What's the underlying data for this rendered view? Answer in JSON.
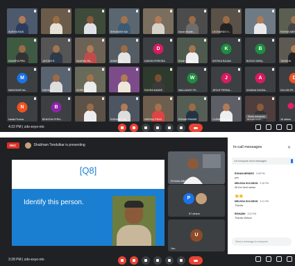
{
  "top_window": {
    "tiles": [
      {
        "kind": "video",
        "name": "SURIYA RAIS",
        "bg": "#4d5a6e",
        "skin": "#b07b55",
        "shirt": "#2b3d5c"
      },
      {
        "kind": "video",
        "name": "",
        "bg": "#6b5b4b",
        "skin": "#9b6b45",
        "shirt": "#e6e1d6"
      },
      {
        "kind": "video",
        "name": "",
        "bg": "#3e4b3a",
        "skin": "#8a5a3a",
        "shirt": "#dfe3e7"
      },
      {
        "kind": "video",
        "name": "SHIVANSH SAI",
        "bg": "#5b6770",
        "skin": "#a3724e",
        "shirt": "#3c5a74"
      },
      {
        "kind": "video",
        "name": "",
        "bg": "#7a6f5e",
        "skin": "#b07b55",
        "shirt": "#d8d3c9"
      },
      {
        "kind": "video",
        "name": "Karan Murde...",
        "bg": "#4c4c4c",
        "skin": "#9b6b45",
        "shirt": "#6d6d6d"
      },
      {
        "kind": "video",
        "name": "LEONARDO V...",
        "bg": "#5a5148",
        "skin": "#9b6b45",
        "shirt": "#222"
      },
      {
        "kind": "video",
        "name": "",
        "bg": "#6e7a84",
        "skin": "#b07b55",
        "shirt": "#eaeaea"
      },
      {
        "kind": "video",
        "name": "ROHAN MENDES",
        "bg": "#5a5f52",
        "skin": "#a3724e",
        "shirt": "#444"
      },
      {
        "kind": "video",
        "name": "DHAIRYA PRA",
        "bg": "#3f5a43",
        "skin": "#9b6b45",
        "shirt": "#333"
      },
      {
        "kind": "video",
        "name": "JAYDEN R",
        "bg": "#555",
        "skin": "#a3724e",
        "shirt": "#2d3a4a"
      },
      {
        "kind": "video",
        "name": "SAURAV PA...",
        "bg": "#6d6256",
        "skin": "#b07b55",
        "shirt": "#c14b4b"
      },
      {
        "kind": "video",
        "name": "ANIKET K...",
        "bg": "#545d64",
        "skin": "#9b6b45",
        "shirt": "#e4e4e4"
      },
      {
        "kind": "avatar",
        "letter": "D",
        "color": "#d81b60",
        "name": "DARON PEREIRA"
      },
      {
        "kind": "video",
        "name": "Rohit Gaikwa...",
        "bg": "#4d5a4d",
        "skin": "#a3724e",
        "shirt": "#eee"
      },
      {
        "kind": "avatar",
        "letter": "K",
        "color": "#1e8e3e",
        "name": "KRITIKA RAJAN"
      },
      {
        "kind": "avatar",
        "letter": "B",
        "color": "#1e8e3e",
        "name": "BOSCO MISQ..."
      },
      {
        "kind": "video",
        "name": "TANISHA",
        "bg": "#5e5a52",
        "skin": "#b07b55",
        "shirt": "#222"
      },
      {
        "kind": "avatar",
        "letter": "M",
        "color": "#1a73e8",
        "name": "MANOHAR NA..."
      },
      {
        "kind": "video",
        "name": "NIKHIL P",
        "bg": "#5a6370",
        "skin": "#9b6b45",
        "shirt": "#ddd"
      },
      {
        "kind": "video",
        "name": "VIVEK RAO",
        "bg": "#6a6a5a",
        "skin": "#a3724e",
        "shirt": "#ececec"
      },
      {
        "kind": "video",
        "name": "",
        "bg": "#7c4b8a",
        "skin": "#b07b55",
        "shirt": "#ede7d9"
      },
      {
        "kind": "video",
        "name": "RUDRA KANDE",
        "bg": "#2e3a2e",
        "skin": "#7a4f30",
        "shirt": "#3a3a3a"
      },
      {
        "kind": "avatar",
        "letter": "W",
        "color": "#1e8e3e",
        "name": "WALLANCE FE..."
      },
      {
        "kind": "avatar",
        "letter": "J",
        "color": "#d81b60",
        "name": "JESLIF FERNA..."
      },
      {
        "kind": "avatar",
        "letter": "A",
        "color": "#d81b60",
        "name": "AYANNA SACBA..."
      },
      {
        "kind": "avatar",
        "letter": "D",
        "color": "#f4511e",
        "name": "DILLON FE..."
      },
      {
        "kind": "avatar",
        "letter": "N",
        "color": "#f4511e",
        "name": "Nadia Pereira"
      },
      {
        "kind": "avatar",
        "letter": "B",
        "color": "#8e24aa",
        "name": "BENSON FERN..."
      },
      {
        "kind": "video",
        "name": "",
        "bg": "#5c5248",
        "skin": "#9b6b45",
        "shirt": "#eee"
      },
      {
        "kind": "video",
        "name": "RISHABH SAT",
        "bg": "#4d5560",
        "skin": "#b07b55",
        "shirt": "#ddd"
      },
      {
        "kind": "video",
        "name": "NEERAJ PRAS",
        "bg": "#6e5e4e",
        "skin": "#a3724e",
        "shirt": "#d44"
      },
      {
        "kind": "video",
        "name": "ROHAN PAWAR",
        "bg": "#555e55",
        "skin": "#9b6b45",
        "shirt": "#234"
      },
      {
        "kind": "video",
        "name": "CLEMENTE FE...",
        "bg": "#5e5e66",
        "skin": "#b07b55",
        "shirt": "#eee"
      },
      {
        "kind": "video",
        "name": "JASON ROD...",
        "bg": "#4e3e3e",
        "skin": "#8a5a3a",
        "shirt": "#333"
      },
      {
        "kind": "more",
        "name": "16 others"
      }
    ],
    "tooltip": "Show everyone",
    "bottom_bar": {
      "time": "4:22 PM",
      "separator": "|",
      "meeting_code": "zdo-exyo-nto"
    }
  },
  "bottom_window": {
    "rec_label": "REC",
    "presenting_text": "Shubham Tendulkar is presenting",
    "slide": {
      "question": "[Q8]",
      "text": "Identify this person."
    },
    "side_tiles": [
      {
        "name": "ROHAN MENDES",
        "kind": "video"
      },
      {
        "name": "97 others",
        "kind": "others"
      },
      {
        "name": "You",
        "kind": "self",
        "letter": "U"
      }
    ],
    "chat": {
      "title": "In-call messages",
      "toggle_label": "Let everyone send messages",
      "messages": [
        {
          "who": "ROHAN MENDES",
          "time": "3:06 PM",
          "body": "yes"
        },
        {
          "who": "MELISSA SOLOMON",
          "time": "3:18 PM",
          "body": "All the best sahas"
        },
        {
          "who": "",
          "time": "",
          "body": "👏👏"
        },
        {
          "who": "MELISSA SOLOMON",
          "time": "3:21 PM",
          "body": "Thanks"
        },
        {
          "who": "RISHABH",
          "time": "3:22 PM",
          "body": "Thanks Wilson"
        }
      ],
      "input_placeholder": "Send a message to everyone"
    },
    "bottom_bar": {
      "time": "3:28 PM",
      "separator": "|",
      "meeting_code": "zdo-exyo-nto"
    }
  },
  "colors": {
    "meet_bg": "#202124",
    "tile_bg": "#3c4043",
    "end_call": "#ea4335",
    "slide_blue": "#1a7fd1"
  }
}
